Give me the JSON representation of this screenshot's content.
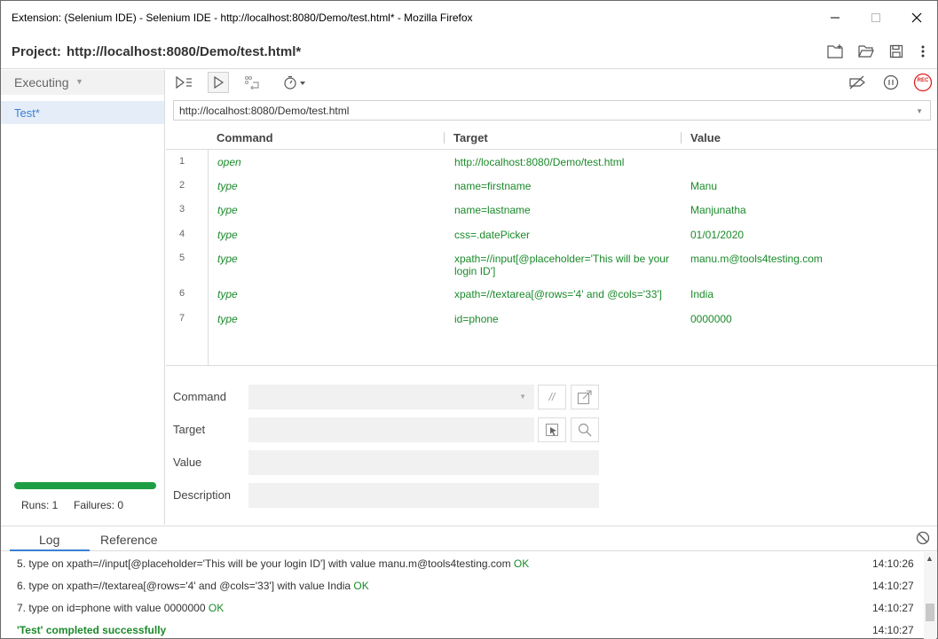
{
  "window": {
    "title": "Extension: (Selenium IDE) - Selenium IDE - http://localhost:8080/Demo/test.html* - Mozilla Firefox",
    "min_icon": "minimize-icon",
    "max_icon": "maximize-icon",
    "close_icon": "close-icon"
  },
  "project": {
    "label": "Project:",
    "name": "http://localhost:8080/Demo/test.html*",
    "icons": [
      "new-project-icon",
      "open-project-icon",
      "save-project-icon",
      "more-icon"
    ]
  },
  "sidebar": {
    "dropdown_label": "Executing",
    "tests": [
      {
        "label": "Test*"
      }
    ],
    "progress_fraction": 1.0,
    "progress_color": "#1e9e43",
    "runs": "Runs: 1",
    "failures": "Failures: 0"
  },
  "toolbar": {
    "icons": [
      "run-all-tests-icon",
      "run-current-test-icon",
      "step-over-icon",
      "speed-icon",
      "disable-breakpoints-icon",
      "pause-icon",
      "record-icon"
    ],
    "record_label": "REC"
  },
  "base_url": {
    "value": "http://localhost:8080/Demo/test.html"
  },
  "table": {
    "headers": {
      "command": "Command",
      "target": "Target",
      "value": "Value"
    },
    "rows": [
      {
        "num": "1",
        "command": "open",
        "target": "http://localhost:8080/Demo/test.html",
        "value": ""
      },
      {
        "num": "2",
        "command": "type",
        "target": "name=firstname",
        "value": "Manu"
      },
      {
        "num": "3",
        "command": "type",
        "target": "name=lastname",
        "value": "Manjunatha"
      },
      {
        "num": "4",
        "command": "type",
        "target": "css=.datePicker",
        "value": "01/01/2020"
      },
      {
        "num": "5",
        "command": "type",
        "target": "xpath=//input[@placeholder='This will be your login ID']",
        "value": "manu.m@tools4testing.com"
      },
      {
        "num": "6",
        "command": "type",
        "target": "xpath=//textarea[@rows='4' and @cols='33']",
        "value": "India"
      },
      {
        "num": "7",
        "command": "type",
        "target": "id=phone",
        "value": "0000000"
      }
    ]
  },
  "editor": {
    "command_label": "Command",
    "target_label": "Target",
    "value_label": "Value",
    "description_label": "Description",
    "comment_button": "//",
    "command_value": "",
    "target_value": "",
    "value_value": "",
    "description_value": ""
  },
  "log": {
    "tabs": [
      "Log",
      "Reference"
    ],
    "active_tab": "Log",
    "lines": [
      {
        "text": "5.  type on xpath=//input[@placeholder='This will be your login ID'] with value manu.m@tools4testing.com",
        "status": "OK",
        "time": "14:10:26"
      },
      {
        "text": "6.  type on xpath=//textarea[@rows='4' and @cols='33'] with value India",
        "status": "OK",
        "time": "14:10:27"
      },
      {
        "text": "7.  type on id=phone with value 0000000",
        "status": "OK",
        "time": "14:10:27"
      },
      {
        "text": "'Test' completed successfully",
        "status": "",
        "time": "14:10:27"
      }
    ]
  }
}
